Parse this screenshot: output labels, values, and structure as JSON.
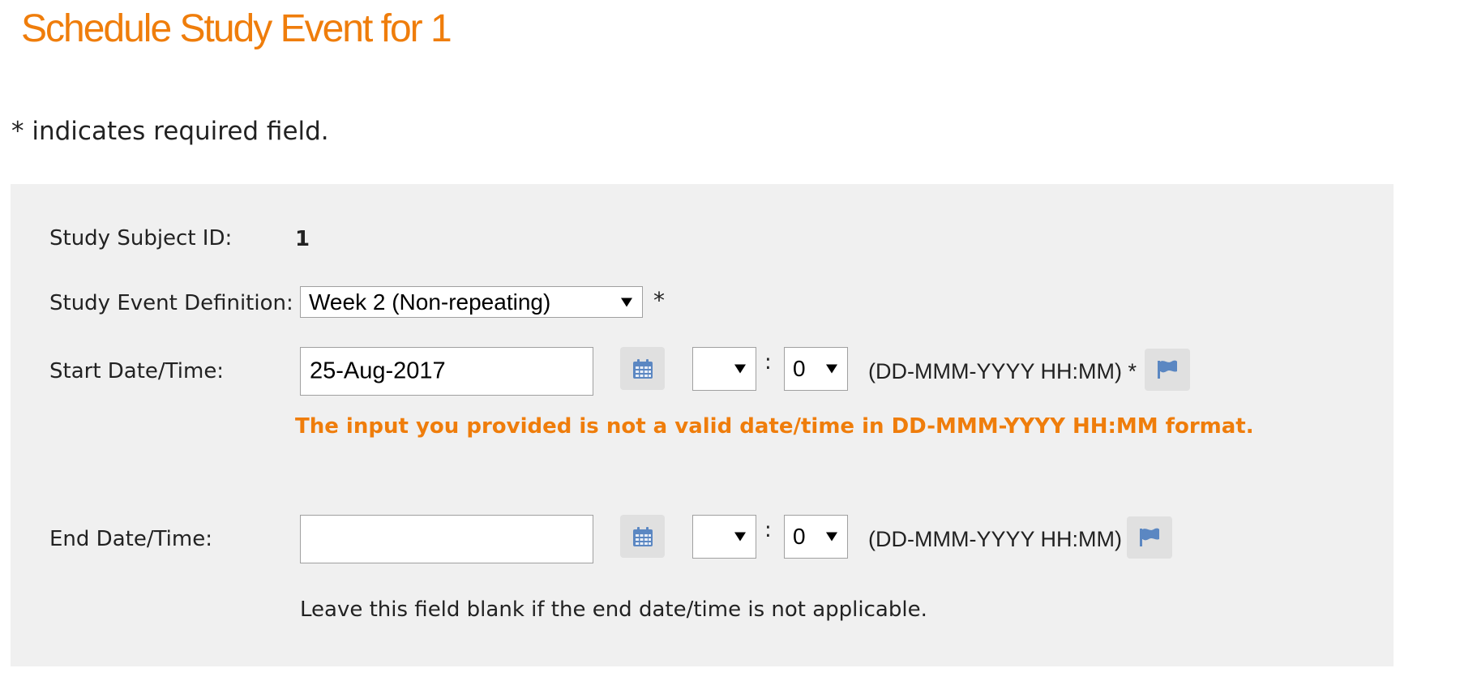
{
  "page": {
    "title": "Schedule Study Event for 1",
    "required_note": "* indicates required field."
  },
  "form": {
    "subject_id": {
      "label": "Study Subject ID:",
      "value": "1"
    },
    "event_definition": {
      "label": "Study Event Definition:",
      "selected": "Week 2 (Non-repeating)",
      "required_mark": "*"
    },
    "start": {
      "label": "Start Date/Time:",
      "date_value": "25-Aug-2017",
      "hour_value": "",
      "minute_value": "0",
      "colon": ":",
      "format_hint": "(DD-MMM-YYYY HH:MM) *",
      "error": "The input you provided is not a valid date/time in DD-MMM-YYYY HH:MM format."
    },
    "end": {
      "label": "End Date/Time:",
      "date_value": "",
      "hour_value": "",
      "minute_value": "0",
      "colon": ":",
      "format_hint": "(DD-MMM-YYYY HH:MM)",
      "help": "Leave this field blank if the end date/time is not applicable."
    }
  },
  "icons": {
    "calendar": "calendar-icon",
    "flag": "flag-icon"
  },
  "colors": {
    "accent": "#ef7d0b",
    "panel_bg": "#f0f0f0",
    "icon_blue": "#5b87c2"
  }
}
